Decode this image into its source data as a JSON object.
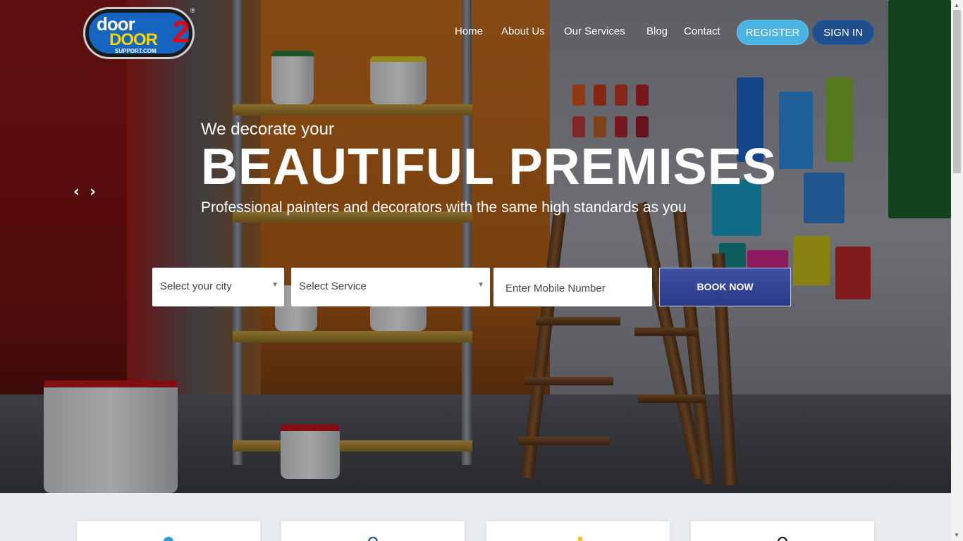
{
  "brand": {
    "logo_line1": "door",
    "logo_line2": "DOOR",
    "logo_two": "2",
    "logo_domain": "SUPPORT.COM",
    "registered": "®"
  },
  "nav": {
    "items": [
      {
        "label": "Home"
      },
      {
        "label": "About Us"
      },
      {
        "label": "Our Services"
      },
      {
        "label": "Blog"
      },
      {
        "label": "Contact"
      }
    ],
    "register_label": "REGISTER",
    "signin_label": "SIGN IN"
  },
  "hero": {
    "tagline": "We decorate your",
    "headline": "BEAUTIFUL PREMISES",
    "subline": "Professional painters and decorators with the same high standards as you",
    "prev_icon": "chevron-left-icon",
    "next_icon": "chevron-right-icon"
  },
  "booking": {
    "city_select": "Select your city",
    "service_select": "Select Service",
    "mobile_placeholder": "Enter Mobile Number",
    "book_label": "BOOK NOW"
  },
  "colors": {
    "register": "#49b4e3",
    "signin": "#1f4e8c",
    "book": "#2f3f8f",
    "section_bg": "#e8ebef"
  },
  "cards": [
    {
      "icon": "service-icon-blue"
    },
    {
      "icon": "service-icon-navy"
    },
    {
      "icon": "service-icon-yellow"
    },
    {
      "icon": "service-icon-black"
    }
  ]
}
